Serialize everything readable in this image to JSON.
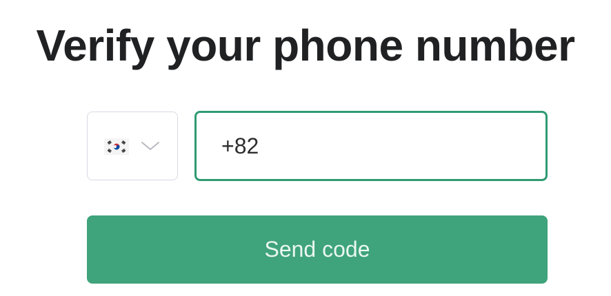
{
  "heading": {
    "title": "Verify your phone number"
  },
  "phone_form": {
    "country": {
      "flag_icon": "south-korea-flag-icon",
      "chevron_icon": "chevron-down-icon"
    },
    "phone_input": {
      "value": "+82"
    },
    "send_button": {
      "label": "Send code"
    }
  },
  "colors": {
    "accent": "#3fa37c",
    "input_border_focus": "#2f9a72",
    "title_text": "#202123",
    "select_border": "#d9d9e3"
  }
}
